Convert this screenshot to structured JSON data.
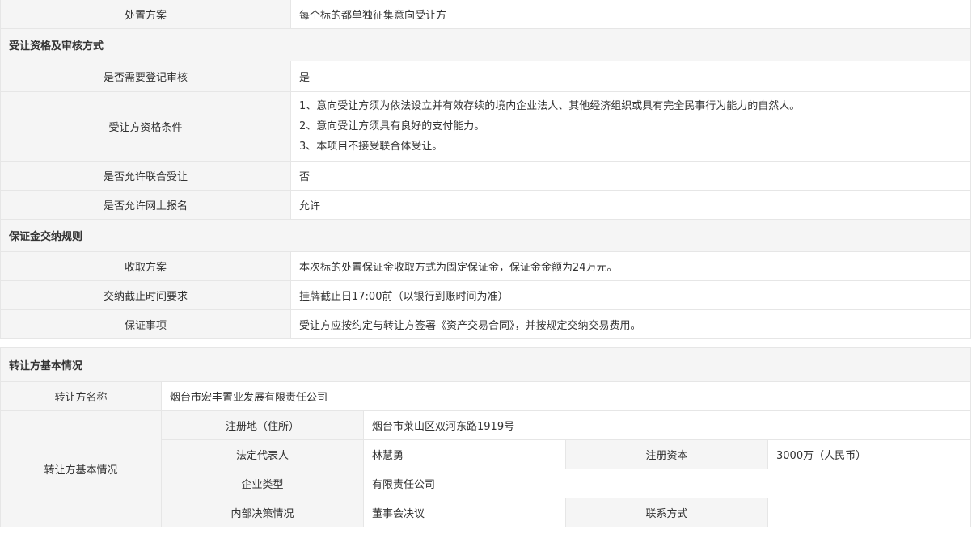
{
  "disposal": {
    "label": "处置方案",
    "value": "每个标的都单独征集意向受让方"
  },
  "qualification": {
    "title": "受让资格及审核方式",
    "rows": [
      {
        "label": "是否需要登记审核",
        "value": "是"
      },
      {
        "label": "受让方资格条件",
        "lines": [
          "1、意向受让方须为依法设立并有效存续的境内企业法人、其他经济组织或具有完全民事行为能力的自然人。",
          "2、意向受让方须具有良好的支付能力。",
          "3、本项目不接受联合体受让。"
        ]
      },
      {
        "label": "是否允许联合受让",
        "value": "否"
      },
      {
        "label": "是否允许网上报名",
        "value": "允许"
      }
    ]
  },
  "deposit": {
    "title": "保证金交纳规则",
    "rows": [
      {
        "label": "收取方案",
        "value": "本次标的处置保证金收取方式为固定保证金，保证金金额为24万元。"
      },
      {
        "label": "交纳截止时间要求",
        "value": "挂牌截止日17:00前（以银行到账时间为准）"
      },
      {
        "label": "保证事项",
        "value": "受让方应按约定与转让方签署《资产交易合同》，并按规定交纳交易费用。"
      }
    ]
  },
  "transferor": {
    "title": "转让方基本情况",
    "name_label": "转让方名称",
    "name_value": "烟台市宏丰置业发展有限责任公司",
    "basic_label": "转让方基本情况",
    "address_label": "注册地（住所）",
    "address_value": "烟台市莱山区双河东路1919号",
    "legal_rep_label": "法定代表人",
    "legal_rep_value": "林慧勇",
    "capital_label": "注册资本",
    "capital_value": "3000万（人民币）",
    "type_label": "企业类型",
    "type_value": "有限责任公司",
    "decision_label": "内部决策情况",
    "decision_value": "董事会决议",
    "contact_label": "联系方式",
    "contact_value": ""
  }
}
